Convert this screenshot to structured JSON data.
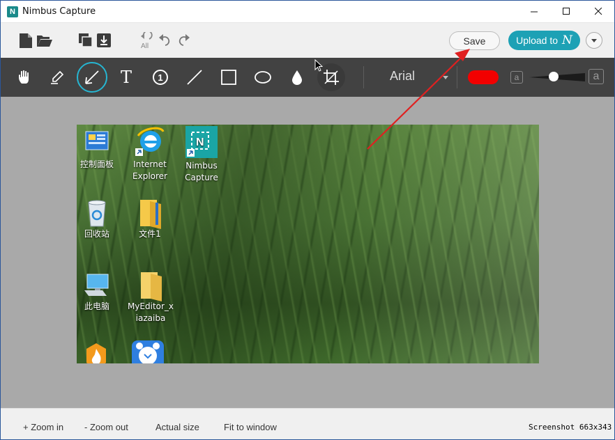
{
  "window": {
    "title": "Nimbus Capture",
    "logo_letter": "N",
    "buttons": [
      "minimize",
      "maximize",
      "close"
    ]
  },
  "toolbar": {
    "save_label": "Save",
    "upload_label": "Upload to",
    "upload_mark": "N",
    "icons": [
      "new-file-icon",
      "open-folder-icon",
      "copy-icon",
      "download-icon",
      "undo-all-icon",
      "undo-icon",
      "redo-icon"
    ],
    "undo_all_text": "All"
  },
  "drawing_tools": {
    "tools": [
      "hand",
      "marker",
      "arrow",
      "text",
      "numbered-step",
      "line",
      "rectangle",
      "ellipse",
      "blur",
      "crop"
    ],
    "active_tool": "arrow",
    "text_tool_glyph": "T",
    "step_glyph": "1",
    "font": "Arial",
    "color": "#f20000",
    "size_small_label": "a",
    "size_large_label": "a",
    "size_level": 0.45
  },
  "desktop": {
    "icons": [
      {
        "label": "控制面板",
        "kind": "control-panel"
      },
      {
        "label": "Internet\nExplorer",
        "kind": "internet-explorer"
      },
      {
        "label": "Nimbus\nCapture",
        "kind": "nimbus-capture"
      },
      {
        "label": "回收站",
        "kind": "recycle-bin"
      },
      {
        "label": "文件1",
        "kind": "folder"
      },
      {
        "label": "此电脑",
        "kind": "this-pc"
      },
      {
        "label": "MyEditor_x\niazaiba",
        "kind": "folder"
      }
    ]
  },
  "status": {
    "zoom_in": "+ Zoom in",
    "zoom_out": "- Zoom out",
    "actual_size": "Actual size",
    "fit_to_window": "Fit to window",
    "screenshot_label": "Screenshot",
    "screenshot_size": "663x343"
  },
  "colors": {
    "accent": "#1da1b5",
    "active_tool_ring": "#26b6d2",
    "draw_bar": "#424242",
    "annotation_arrow": "#e02020"
  }
}
